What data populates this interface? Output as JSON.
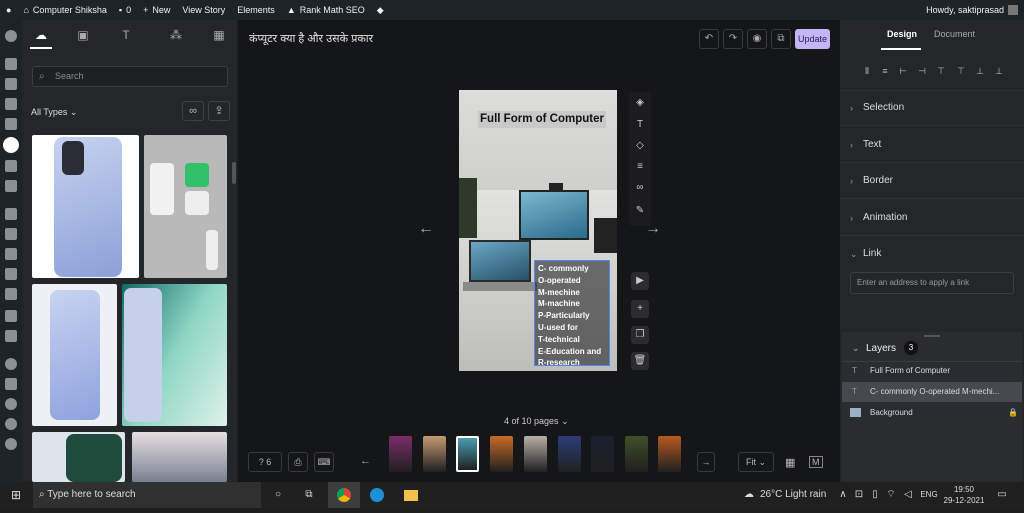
{
  "wpbar": {
    "site": "Computer Shiksha",
    "comments": "0",
    "new": "New",
    "view": "View Story",
    "elements": "Elements",
    "seo": "Rank Math SEO",
    "howdy": "Howdy, saktiprasad"
  },
  "library": {
    "search_placeholder": "Search",
    "filter": "All Types"
  },
  "canvas": {
    "story_title": "कंप्यूटर क्या है और उसके प्रकार",
    "update": "Update",
    "page_heading": "Full Form of Computer",
    "page_lines": [
      "C- commonly",
      "O-operated",
      "M-mechine",
      "M-machine",
      "P-Particularly",
      "U-used for",
      "T-technical",
      "E-Education and",
      "R-research"
    ],
    "page_counter": "4 of 10 pages",
    "help_count": "6",
    "zoom": "Fit",
    "thumb_colors": [
      "#7c2c6a",
      "#c69a72",
      "#4b9bb0",
      "#c86a2a",
      "#b8b0a6",
      "#2d3d78",
      "#1b2030",
      "#3f4f2a",
      "#b85a20"
    ]
  },
  "design": {
    "tabs": [
      "Design",
      "Document"
    ],
    "sections": [
      "Selection",
      "Text",
      "Border",
      "Animation",
      "Link"
    ],
    "link_placeholder": "Enter an address to apply a link",
    "layers_title": "Layers",
    "layers_count": "3",
    "layers": [
      "Full Form of Computer",
      "C- commonly O-operated M-mechi...",
      "Background"
    ]
  },
  "taskbar": {
    "search": "Type here to search",
    "weather": "26°C  Light rain",
    "lang": "ENG",
    "time": "19:50",
    "date": "29-12-2021"
  }
}
